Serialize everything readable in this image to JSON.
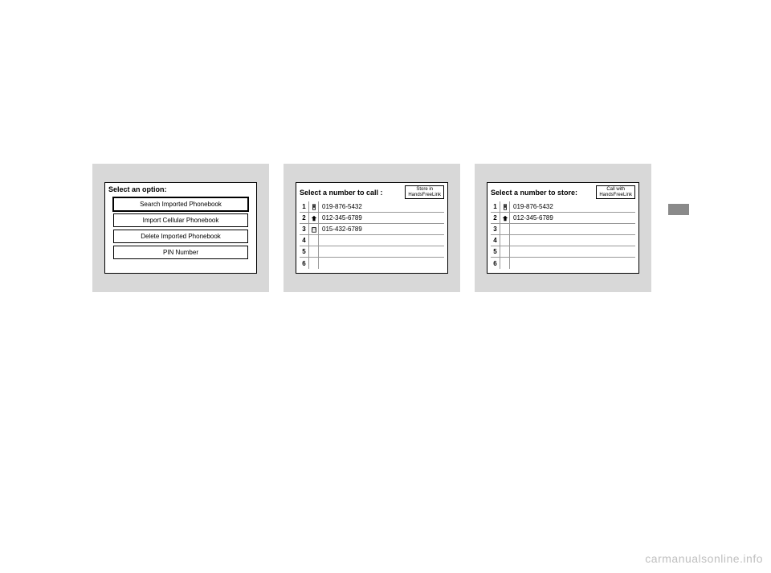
{
  "screen1": {
    "title": "Select  an  option:",
    "options": [
      "Search Imported Phonebook",
      "Import  Cellular  Phonebook",
      "Delete Imported Phonebook",
      "PIN Number"
    ]
  },
  "screen2": {
    "title": "Select a number to call :",
    "corner_button": "Store in\nHandsFreeLink",
    "rows": [
      {
        "index": "1",
        "icon": "mobile",
        "number": "019-876-5432"
      },
      {
        "index": "2",
        "icon": "home",
        "number": "012-345-6789"
      },
      {
        "index": "3",
        "icon": "work",
        "number": "015-432-6789"
      },
      {
        "index": "4",
        "icon": "",
        "number": ""
      },
      {
        "index": "5",
        "icon": "",
        "number": ""
      },
      {
        "index": "6",
        "icon": "",
        "number": ""
      }
    ]
  },
  "screen3": {
    "title": "Select a number to store:",
    "corner_button": "Call with\nHandsFreeLink",
    "rows": [
      {
        "index": "1",
        "icon": "mobile",
        "number": "019-876-5432"
      },
      {
        "index": "2",
        "icon": "home",
        "number": "012-345-6789"
      },
      {
        "index": "3",
        "icon": "",
        "number": ""
      },
      {
        "index": "4",
        "icon": "",
        "number": ""
      },
      {
        "index": "5",
        "icon": "",
        "number": ""
      },
      {
        "index": "6",
        "icon": "",
        "number": ""
      }
    ]
  },
  "watermark": "carmanualsonline.info"
}
